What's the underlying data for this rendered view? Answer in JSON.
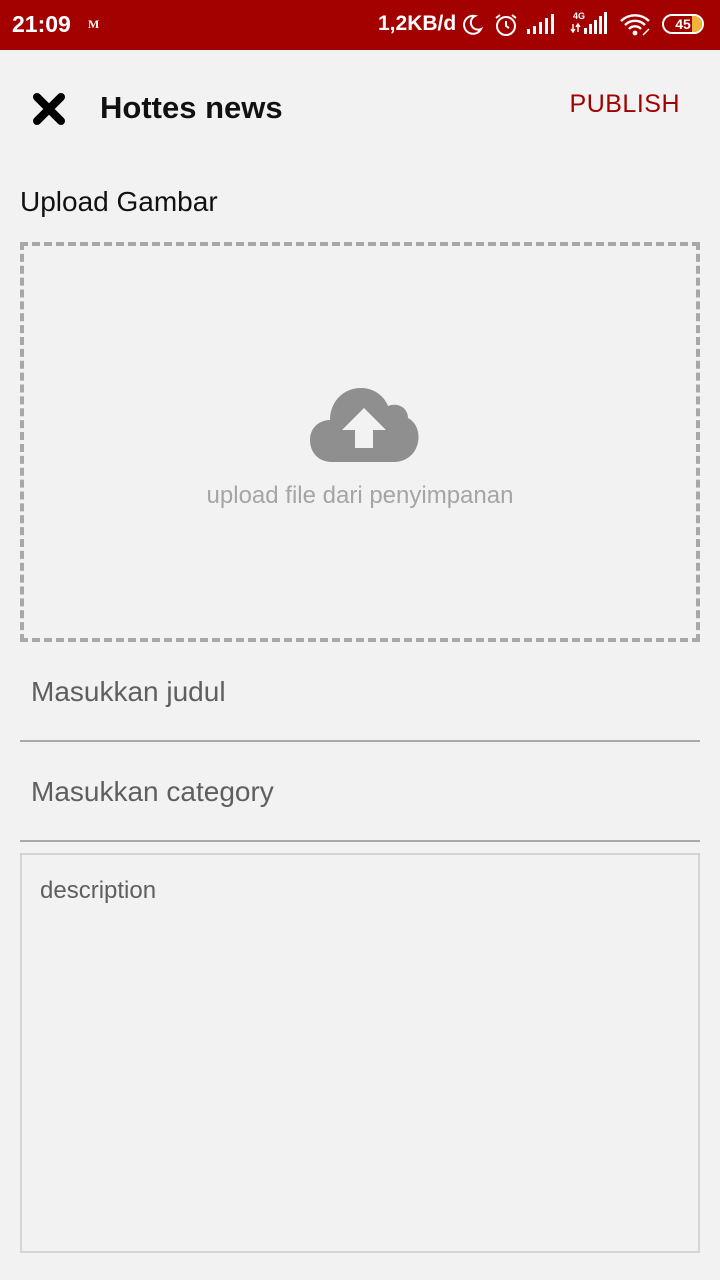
{
  "status_bar": {
    "time": "21:09",
    "mail_indicator": "M",
    "network_speed": "1,2KB/d",
    "network_type": "4G",
    "battery_level": "45",
    "icons": [
      "mail-icon",
      "moon-icon",
      "alarm-icon",
      "signal-icon",
      "signal-4g-icon",
      "wifi-icon",
      "battery-icon"
    ]
  },
  "toolbar": {
    "close_icon": "close-icon",
    "title": "Hottes news",
    "publish_label": "PUBLISH"
  },
  "form": {
    "upload_label": "Upload Gambar",
    "upload_icon": "cloud-upload-icon",
    "upload_hint": "upload file dari penyimpanan",
    "title_placeholder": "Masukkan judul",
    "title_value": "",
    "category_placeholder": "Masukkan category",
    "category_value": "",
    "description_placeholder": "description",
    "description_value": ""
  },
  "colors": {
    "accent": "#a30000",
    "background": "#f2f2f2",
    "dashed_border": "#a8a8a8",
    "icon_gray": "#8f8f8f"
  }
}
